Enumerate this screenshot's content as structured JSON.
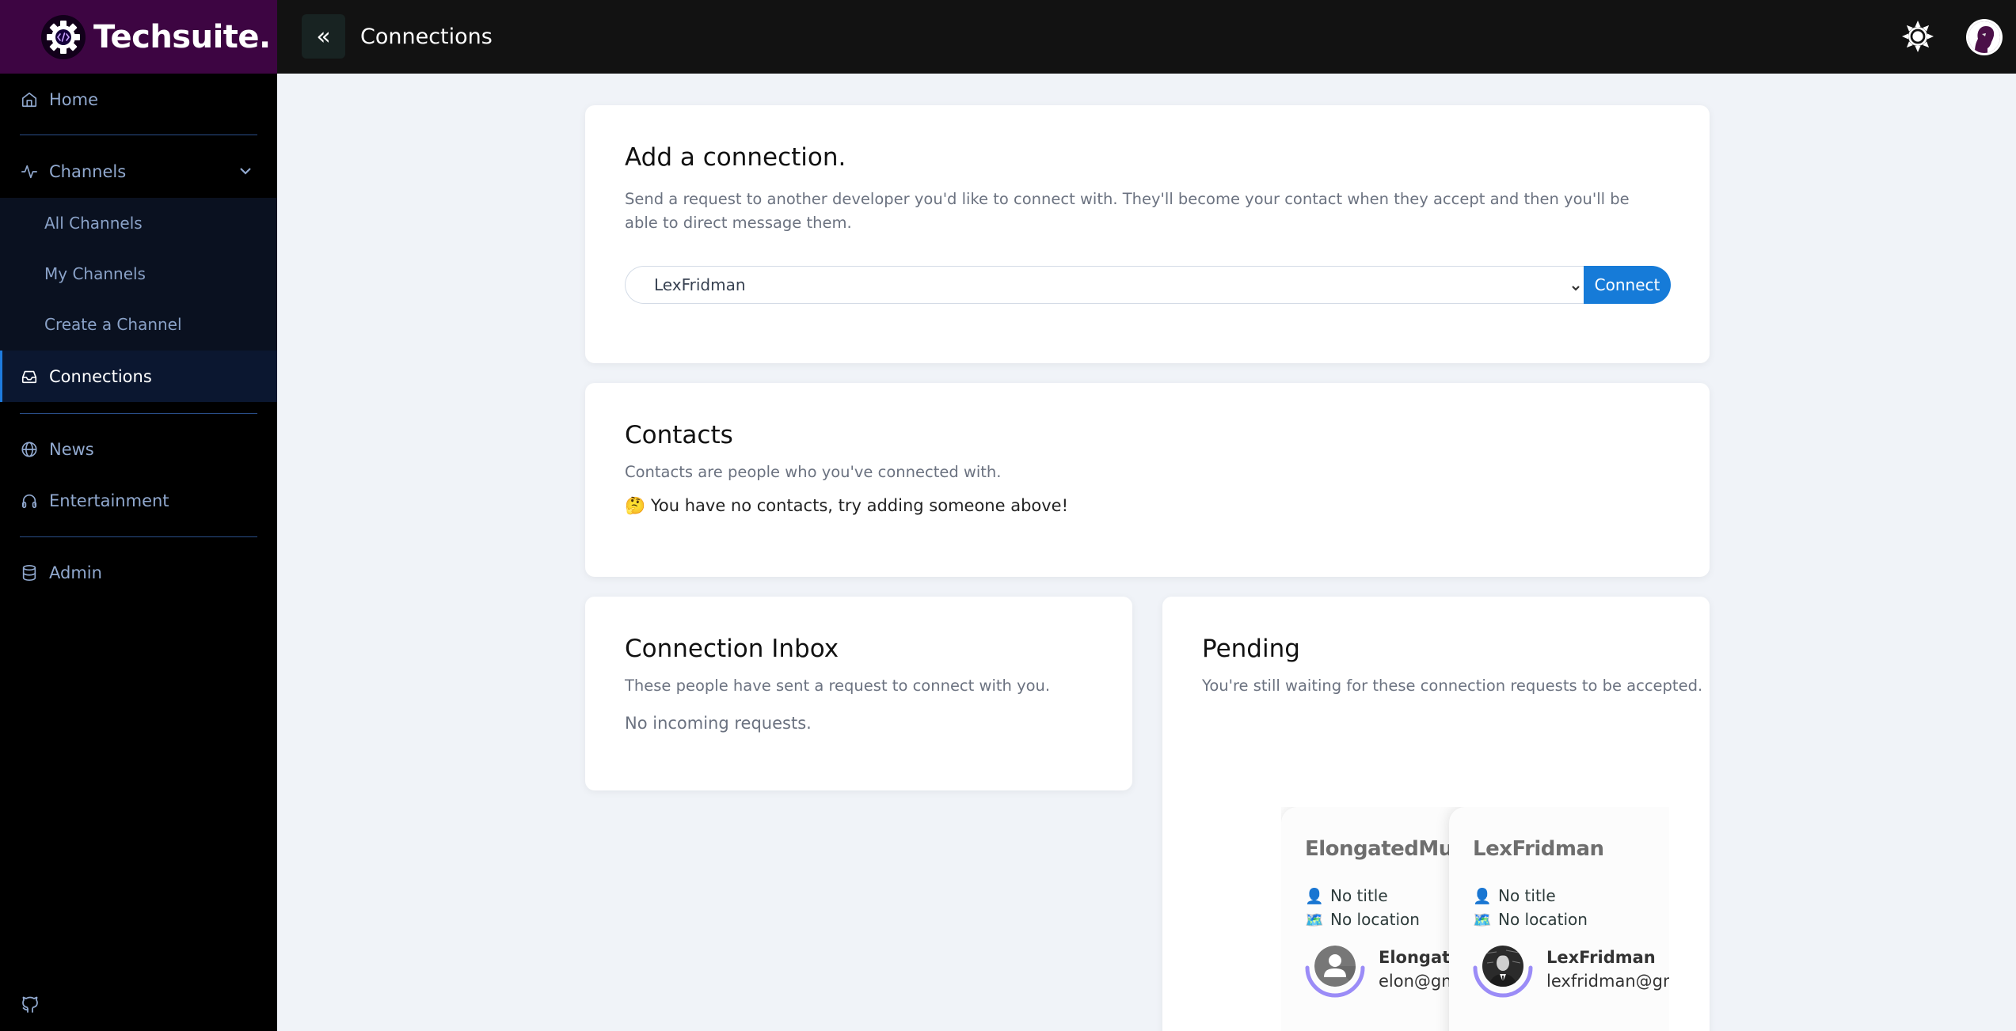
{
  "app": {
    "brand_name": "Techsuite.",
    "page_title": "Connections"
  },
  "colors": {
    "brand_bg": "#3d0542",
    "accent": "#167bd8",
    "sidebar_text": "#91a9cf",
    "ring": "#9b8cf7"
  },
  "sidebar": {
    "items": [
      {
        "label": "Home",
        "icon": "home-icon"
      },
      {
        "label": "Channels",
        "icon": "activity-icon",
        "expanded": true,
        "children": [
          {
            "label": "All Channels"
          },
          {
            "label": "My Channels"
          },
          {
            "label": "Create a Channel"
          }
        ]
      },
      {
        "label": "Connections",
        "icon": "inbox-icon",
        "active": true
      },
      {
        "label": "News",
        "icon": "globe-icon"
      },
      {
        "label": "Entertainment",
        "icon": "headphones-icon"
      },
      {
        "label": "Admin",
        "icon": "database-icon"
      }
    ],
    "footer_icon": "github-icon"
  },
  "header": {
    "collapse_icon": "double-chevron-left-icon",
    "collapse_glyph": "«",
    "theme_icon": "sun-icon",
    "avatar_icon": "user-avatar"
  },
  "add_connection": {
    "title": "Add a connection.",
    "description": "Send a request to another developer you'd like to connect with. They'll become your contact when they accept and then you'll be able to direct message them.",
    "selected_user": "LexFridman",
    "connect_label": "Connect"
  },
  "contacts": {
    "title": "Contacts",
    "description": "Contacts are people who you've connected with.",
    "empty_emoji": "🤔",
    "empty_message": "You have no contacts, try adding someone above!"
  },
  "inbox": {
    "title": "Connection Inbox",
    "description": "These people have sent a request to connect with you.",
    "empty_message": "No incoming requests."
  },
  "pending": {
    "title": "Pending",
    "description": "You're still waiting for these connection requests to be accepted.",
    "users": [
      {
        "display_name": "ElongatedMuskrat",
        "title": "No title",
        "location": "No location",
        "username": "ElongatedMuskrat",
        "email": "elon@gmail.com",
        "title_emoji": "👤",
        "location_emoji": "🗺️"
      },
      {
        "display_name": "LexFridman",
        "title": "No title",
        "location": "No location",
        "username": "LexFridman",
        "email": "lexfridman@gmail.com",
        "title_emoji": "👤",
        "location_emoji": "🗺️"
      }
    ]
  }
}
